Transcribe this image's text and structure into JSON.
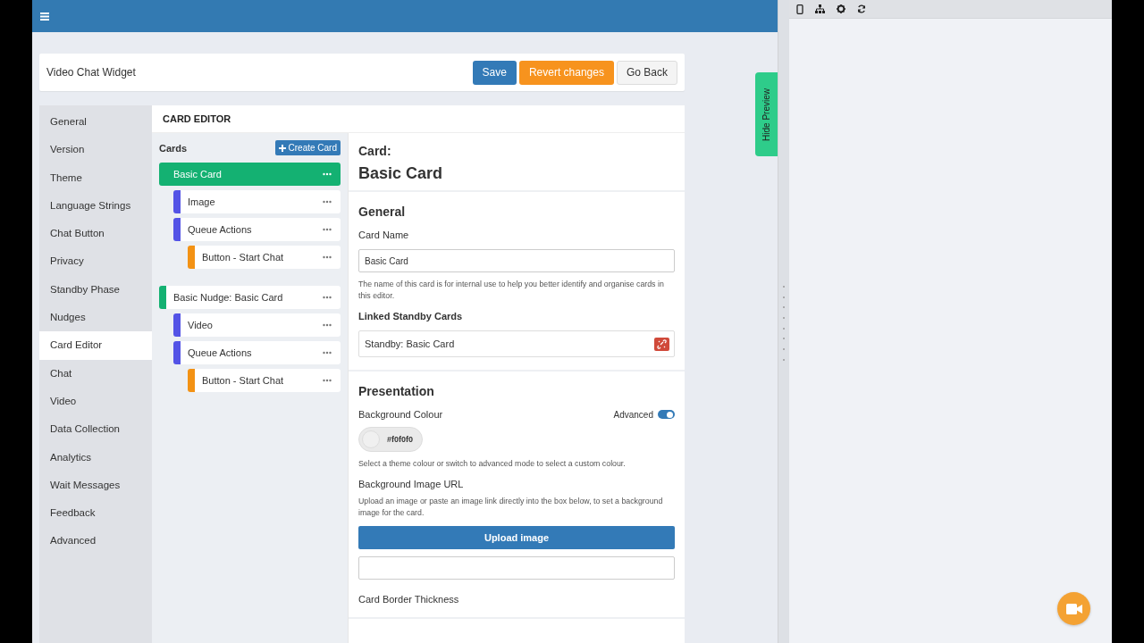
{
  "header": {
    "title": "Video Chat Widget",
    "buttons": [
      {
        "label": "Save",
        "kind": "primary"
      },
      {
        "label": "Revert changes",
        "kind": "warning"
      },
      {
        "label": "Go Back",
        "kind": "default"
      }
    ]
  },
  "sidebar": {
    "items": [
      {
        "label": "General",
        "selected": false
      },
      {
        "label": "Version",
        "selected": false
      },
      {
        "label": "Theme",
        "selected": false
      },
      {
        "label": "Language Strings",
        "selected": false
      },
      {
        "label": "Chat Button",
        "selected": false
      },
      {
        "label": "Privacy",
        "selected": false
      },
      {
        "label": "Standby Phase",
        "selected": false
      },
      {
        "label": "Nudges",
        "selected": false
      },
      {
        "label": "Card Editor",
        "selected": true
      },
      {
        "label": "Chat",
        "selected": false
      },
      {
        "label": "Video",
        "selected": false
      },
      {
        "label": "Data Collection",
        "selected": false
      },
      {
        "label": "Analytics",
        "selected": false
      },
      {
        "label": "Wait Messages",
        "selected": false
      },
      {
        "label": "Feedback",
        "selected": false
      },
      {
        "label": "Advanced",
        "selected": false
      }
    ]
  },
  "editor": {
    "title": "CARD EDITOR",
    "cards_heading": "Cards",
    "create_button": "Create Card",
    "cards": [
      {
        "label": "Basic Card",
        "color": "#14b172",
        "selected": true,
        "children": [
          {
            "label": "Image",
            "color": "#5353e6",
            "selected": false
          },
          {
            "label": "Queue Actions",
            "color": "#5353e6",
            "selected": false,
            "children": [
              {
                "label": "Button - Start Chat",
                "color": "#f39214",
                "selected": false
              }
            ]
          }
        ]
      },
      {
        "label": "Basic Nudge: Basic Card",
        "color": "#14b172",
        "selected": false,
        "children": [
          {
            "label": "Video",
            "color": "#5353e6",
            "selected": false
          },
          {
            "label": "Queue Actions",
            "color": "#5353e6",
            "selected": false,
            "children": [
              {
                "label": "Button - Start Chat",
                "color": "#f39214",
                "selected": false
              }
            ]
          }
        ]
      }
    ]
  },
  "detail": {
    "card_label": "Card:",
    "card_title": "Basic Card",
    "general": {
      "heading": "General",
      "name_label": "Card Name",
      "name_value": "Basic Card",
      "name_help": "The name of this card is for internal use to help you better identify and organise cards in this editor.",
      "linked_label": "Linked Standby Cards",
      "linked_value": "Standby: Basic Card"
    },
    "presentation": {
      "heading": "Presentation",
      "bg_label": "Background Colour",
      "advanced_label": "Advanced",
      "advanced_on": true,
      "bg_value": "#f0f0f0",
      "bg_help": "Select a theme colour or switch to advanced mode to select a custom colour.",
      "image_label": "Background Image URL",
      "image_help": "Upload an image or paste an image link directly into the box below, to set a background image for the card.",
      "upload_button": "Upload image",
      "border_label": "Card Border Thickness"
    }
  },
  "preview": {
    "hide_button": "Hide Preview"
  }
}
